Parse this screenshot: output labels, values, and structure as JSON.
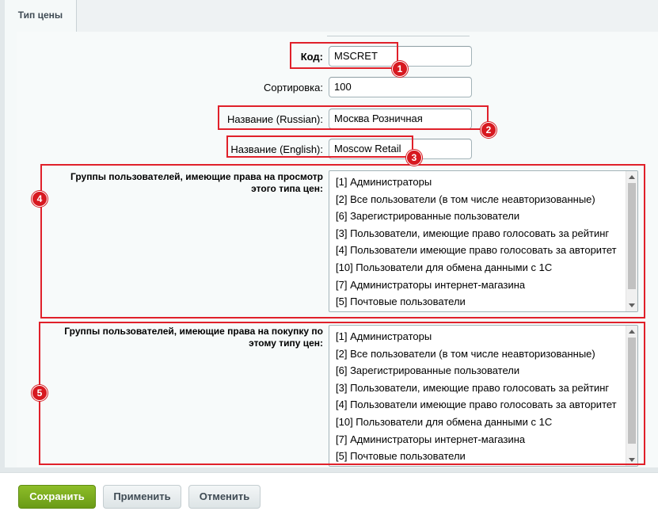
{
  "tab": {
    "title": "Тип цены"
  },
  "form": {
    "code": {
      "label": "Код:",
      "value": "MSCRET"
    },
    "sort": {
      "label": "Сортировка:",
      "value": "100"
    },
    "name_ru": {
      "label": "Название (Russian):",
      "value": "Москва Розничная"
    },
    "name_en": {
      "label": "Название (English):",
      "value": "Moscow Retail"
    },
    "view_groups": {
      "label_line1": "Группы пользователей, имеющие права на просмотр",
      "label_line2": "этого типа цен:",
      "options": [
        "[1] Администраторы",
        "[2] Все пользователи (в том числе неавторизованные)",
        "[6] Зарегистрированные пользователи",
        "[3] Пользователи, имеющие право голосовать за рейтинг",
        "[4] Пользователи имеющие право голосовать за авторитет",
        "[10] Пользователи для обмена данными с 1С",
        "[7] Администраторы интернет-магазина",
        "[5] Почтовые пользователи"
      ]
    },
    "buy_groups": {
      "label_line1": "Группы пользователей, имеющие права на покупку по",
      "label_line2": "этому типу цен:",
      "options": [
        "[1] Администраторы",
        "[2] Все пользователи (в том числе неавторизованные)",
        "[6] Зарегистрированные пользователи",
        "[3] Пользователи, имеющие право голосовать за рейтинг",
        "[4] Пользователи имеющие право голосовать за авторитет",
        "[10] Пользователи для обмена данными с 1С",
        "[7] Администраторы интернет-магазина",
        "[5] Почтовые пользователи"
      ]
    }
  },
  "annotations": {
    "b1": "1",
    "b2": "2",
    "b3": "3",
    "b4": "4",
    "b5": "5",
    "highlight_color": "#e0202a"
  },
  "footer": {
    "save": "Сохранить",
    "apply": "Применить",
    "cancel": "Отменить"
  }
}
